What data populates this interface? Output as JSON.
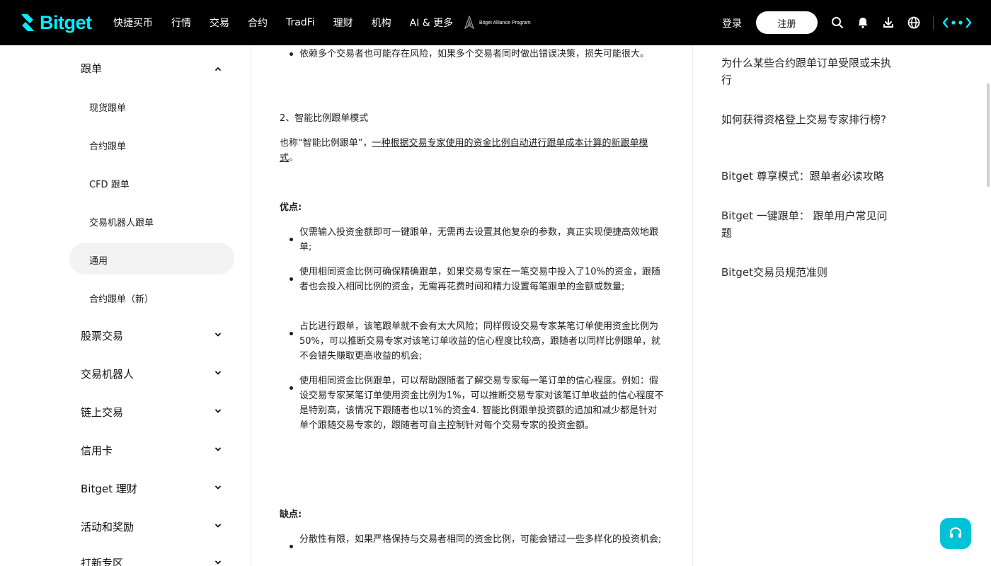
{
  "brand": {
    "name": "Bitget",
    "accent": "#00f0ff",
    "alliance": "Bitget Alliance Program"
  },
  "nav": {
    "items": [
      "快捷买币",
      "行情",
      "交易",
      "合约",
      "TradFi",
      "理财",
      "机构",
      "AI & 更多"
    ]
  },
  "header": {
    "login": "登录",
    "register": "注册",
    "icons": [
      "search-icon",
      "bell-icon",
      "download-icon",
      "globe-icon",
      "dots-icon"
    ]
  },
  "sidebar": {
    "copy_trading": {
      "label": "跟单",
      "expanded": true,
      "items": [
        "现货跟单",
        "合约跟单",
        "CFD 跟单",
        "交易机器人跟单",
        "通用",
        "合约跟单（新）"
      ],
      "active": "通用"
    },
    "sections": [
      "股票交易",
      "交易机器人",
      "链上交易",
      "信用卡",
      "Bitget 理财",
      "活动和奖励",
      "打新专区"
    ]
  },
  "article": {
    "risk_bullet": "依赖多个交易者也可能存在风险，如果多个交易者同时做出错误决策，损失可能很大。",
    "mode2_heading": "2、智能比例跟单模式",
    "mode2_intro_prefix": "也称“智能比例跟单”，",
    "mode2_intro_link": "一种根据交易专家使用的资金比例自动进行跟单成本计算的新跟单模式",
    "mode2_intro_suffix": "。",
    "pros_heading": "优点:",
    "pros": [
      "仅需输入投资金额即可一键跟单，无需再去设置其他复杂的参数，真正实现便捷高效地跟单;",
      "使用相同资金比例可确保精确跟单，如果交易专家在一笔交易中投入了10%的资金，跟随者也会投入相同比例的资金，无需再花费时间和精力设置每笔跟单的金额或数量;",
      "占比进行跟单，该笔跟单就不会有太大风险；同样假设交易专家某笔订单使用资金比例为50%，可以推断交易专家对该笔订单收益的信心程度比较高，跟随者以同样比例跟单，就不会错失赚取更高收益的机会;",
      "使用相同资金比例跟单，可以帮助跟随者了解交易专家每一笔订单的信心程度。例如：假设交易专家某笔订单使用资金比例为1%，可以推断交易专家对该笔订单收益的信心程度不是特别高，该情况下跟随者也以1%的资金4. 智能比例跟单投资额的追加和减少都是针对单个跟随交易专家的，跟随者可自主控制针对每个交易专家的投资金额。"
    ],
    "cons_heading": "缺点:",
    "cons": [
      "分散性有限，如果严格保持与交易者相同的资金比例，可能会错过一些多样化的投资机会;"
    ]
  },
  "related": [
    "为什么某些合约跟单订单受限或未执行",
    "如何获得资格登上交易专家排行榜?",
    "Bitget 尊享模式：跟单者必读攻略",
    "Bitget 一键跟单：  跟单用户常见问题",
    "Bitget交易员规范准则"
  ],
  "support": {
    "icon": "headset-icon",
    "color": "#00c2d6"
  }
}
